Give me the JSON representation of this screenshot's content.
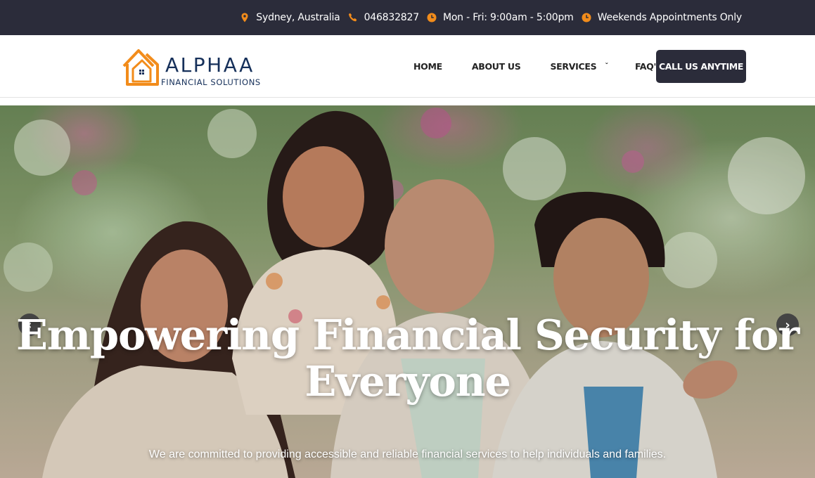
{
  "topbar": {
    "location": "Sydney, Australia",
    "phone": "046832827",
    "hours": "Mon - Fri: 9:00am - 5:00pm",
    "weekends": "Weekends Appointments Only",
    "icon_color": "#f28c1b",
    "icons": [
      "location-pin-icon",
      "phone-icon",
      "clock-icon",
      "clock-icon"
    ]
  },
  "header": {
    "logo": {
      "name": "ALPHAA",
      "tagline": "FINANCIAL SOLUTIONS",
      "icon": "house-logo-icon",
      "accent": "#f28c1b",
      "text_color": "#16305a"
    },
    "nav": [
      {
        "label": "HOME"
      },
      {
        "label": "ABOUT US"
      },
      {
        "label": "SERVICES",
        "icon": "chevron-down-icon"
      },
      {
        "label": "FAQ'S"
      }
    ],
    "cta_label": "CALL US ANYTIME",
    "cta_color": "#2b2c3a"
  },
  "hero": {
    "title": "Empowering Financial Security for Everyone",
    "subtitle": "We are committed to providing accessible and reliable financial services to help individuals and families.",
    "prev_icon": "chevron-left-icon",
    "next_icon": "chevron-right-icon",
    "image": "family-photo"
  }
}
